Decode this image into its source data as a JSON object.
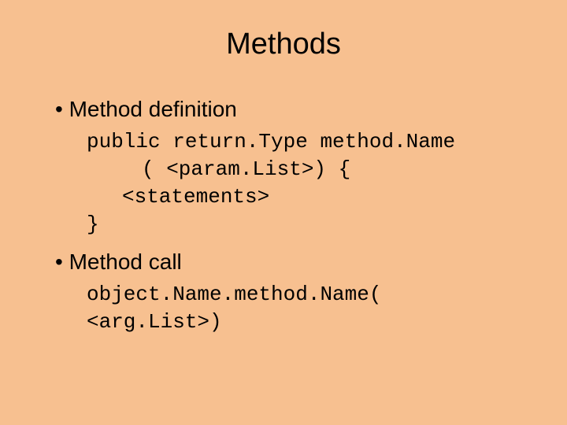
{
  "title": "Methods",
  "bullets": {
    "definition": "Method definition",
    "call": "Method call"
  },
  "code": {
    "def_line1": "public return.Type method.Name",
    "def_line2": "( <param.List>) {",
    "def_line3": "<statements>",
    "def_line4": "}",
    "call_line": "object.Name.method.Name( <arg.List>)"
  }
}
